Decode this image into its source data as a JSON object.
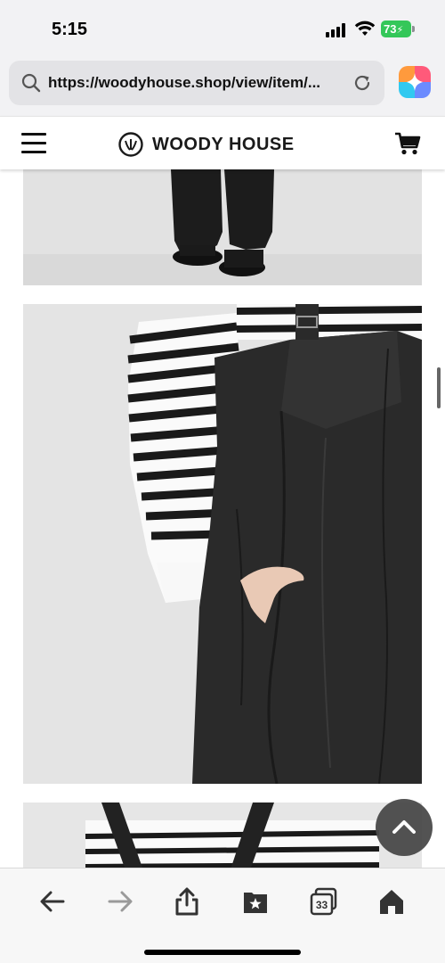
{
  "status_bar": {
    "time": "5:15",
    "battery_level": "73",
    "icons": [
      "signal-icon",
      "wifi-icon",
      "battery-icon"
    ]
  },
  "browser": {
    "url": "https://woodyhouse.shop/view/item/...",
    "icons": [
      "search-icon",
      "reload-icon",
      "app-icon"
    ]
  },
  "site_header": {
    "logo_text": "WOODY HOUSE",
    "icons": [
      "menu-icon",
      "logo-icon",
      "cart-icon"
    ]
  },
  "content": {
    "photos": [
      {
        "description_key": "product-photo-1"
      },
      {
        "description_key": "product-photo-2"
      },
      {
        "description_key": "product-photo-3"
      }
    ],
    "scroll_top_icon": "chevron-up-icon"
  },
  "toolbar": {
    "tabs_count": "33",
    "icons": [
      "back-icon",
      "forward-icon",
      "share-icon",
      "bookmarks-icon",
      "tabs-icon",
      "home-icon"
    ]
  },
  "colors": {
    "chrome_bg": "#f2f2f4",
    "battery": "#34c759",
    "text": "#111111",
    "forward_disabled": "#9a9a9a"
  }
}
